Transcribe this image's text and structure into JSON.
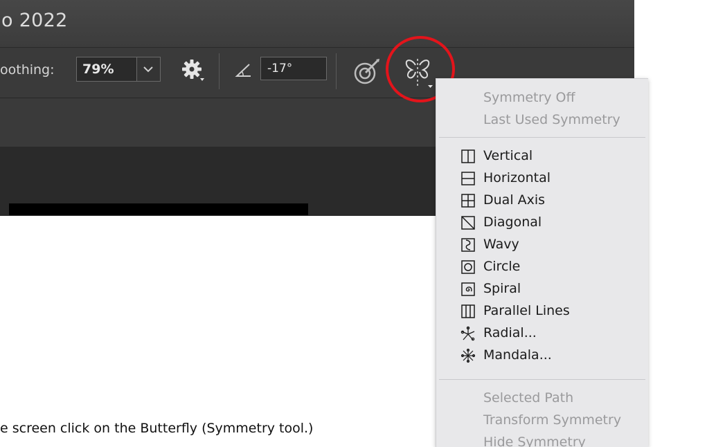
{
  "window": {
    "title": "o 2022"
  },
  "options_bar": {
    "smoothing_label": "oothing:",
    "smoothing_value": "79%",
    "angle_value": "-17°"
  },
  "icons": {
    "smoothing_dropdown": "chevron-down-icon",
    "settings": "gear-icon",
    "angle": "angle-icon",
    "pressure": "pressure-icon",
    "symmetry": "butterfly-icon"
  },
  "highlight_color": "#e3141b",
  "caption": "e screen click on the Butterfly (Symmetry tool.)",
  "symmetry_menu": {
    "header_items": [
      {
        "label": "Symmetry Off",
        "enabled": false
      },
      {
        "label": "Last Used Symmetry",
        "enabled": false
      }
    ],
    "symmetry_types": [
      {
        "label": "Vertical",
        "icon": "vertical-symmetry-icon"
      },
      {
        "label": "Horizontal",
        "icon": "horizontal-symmetry-icon"
      },
      {
        "label": "Dual Axis",
        "icon": "dual-axis-icon"
      },
      {
        "label": "Diagonal",
        "icon": "diagonal-icon"
      },
      {
        "label": "Wavy",
        "icon": "wavy-icon"
      },
      {
        "label": "Circle",
        "icon": "circle-icon"
      },
      {
        "label": "Spiral",
        "icon": "spiral-icon"
      },
      {
        "label": "Parallel Lines",
        "icon": "parallel-lines-icon"
      },
      {
        "label": "Radial...",
        "icon": "radial-icon"
      },
      {
        "label": "Mandala...",
        "icon": "mandala-icon"
      }
    ],
    "footer_items": [
      {
        "label": "Selected Path",
        "enabled": false
      },
      {
        "label": "Transform Symmetry",
        "enabled": false
      },
      {
        "label": "Hide Symmetry",
        "enabled": false
      }
    ]
  }
}
